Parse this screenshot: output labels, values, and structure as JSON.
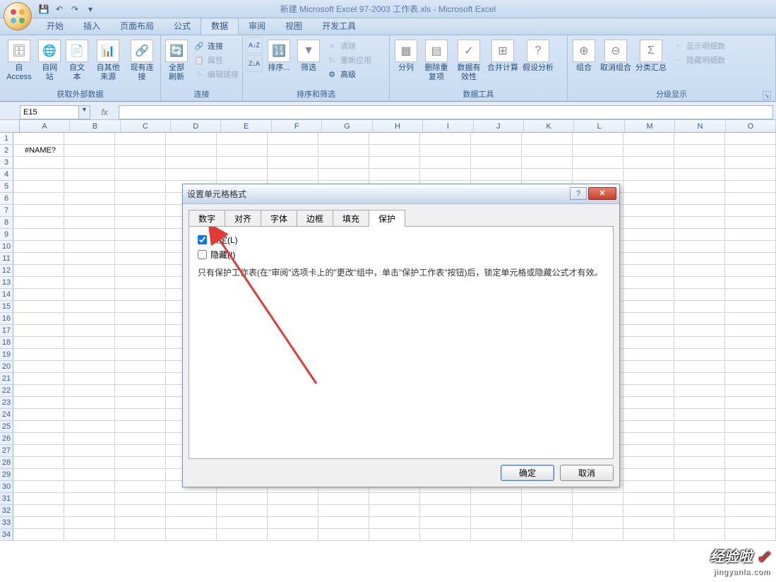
{
  "window": {
    "title": "新建 Microsoft Excel 97-2003 工作表.xls - Microsoft Excel"
  },
  "tabs": [
    "开始",
    "插入",
    "页面布局",
    "公式",
    "数据",
    "审阅",
    "视图",
    "开发工具"
  ],
  "active_tab_index": 4,
  "ribbon": {
    "groups": [
      {
        "label": "获取外部数据",
        "big": [
          {
            "l": "自 Access"
          },
          {
            "l": "自网站"
          },
          {
            "l": "自文本"
          },
          {
            "l": "自其他来源"
          },
          {
            "l": "现有连接"
          }
        ]
      },
      {
        "label": "连接",
        "big": [
          {
            "l": "全部刷新"
          }
        ],
        "small": [
          "连接",
          "属性",
          "编辑链接"
        ]
      },
      {
        "label": "排序和筛选",
        "big": [
          {
            "l": "A↓Z"
          },
          {
            "l": "Z↓A"
          },
          {
            "l": "排序..."
          },
          {
            "l": "筛选"
          }
        ],
        "small": [
          "清除",
          "重新应用",
          "高级"
        ]
      },
      {
        "label": "数据工具",
        "big": [
          {
            "l": "分列"
          },
          {
            "l": "删除重复项"
          },
          {
            "l": "数据有效性"
          },
          {
            "l": "合并计算"
          },
          {
            "l": "假设分析"
          }
        ]
      },
      {
        "label": "分级显示",
        "big": [
          {
            "l": "组合"
          },
          {
            "l": "取消组合"
          },
          {
            "l": "分类汇总"
          }
        ],
        "small": [
          "显示明细数",
          "隐藏明细数"
        ]
      }
    ]
  },
  "namebox": "E15",
  "columns": [
    "A",
    "B",
    "C",
    "D",
    "E",
    "F",
    "G",
    "H",
    "I",
    "J",
    "K",
    "L",
    "M",
    "N",
    "O"
  ],
  "row_count": 34,
  "cell_b2": "#NAME?",
  "dialog": {
    "title": "设置单元格格式",
    "tabs": [
      "数字",
      "对齐",
      "字体",
      "边框",
      "填充",
      "保护"
    ],
    "active": 5,
    "locked_label": "锁定(L)",
    "hidden_label": "隐藏(I)",
    "locked_checked": true,
    "hidden_checked": false,
    "note": "只有保护工作表(在\"审阅\"选项卡上的\"更改\"组中，单击\"保护工作表\"按钮)后，锁定单元格或隐藏公式才有效。",
    "ok": "确定",
    "cancel": "取消"
  },
  "watermark": {
    "line1": "经验啦",
    "line2": "jingyanla.com"
  }
}
